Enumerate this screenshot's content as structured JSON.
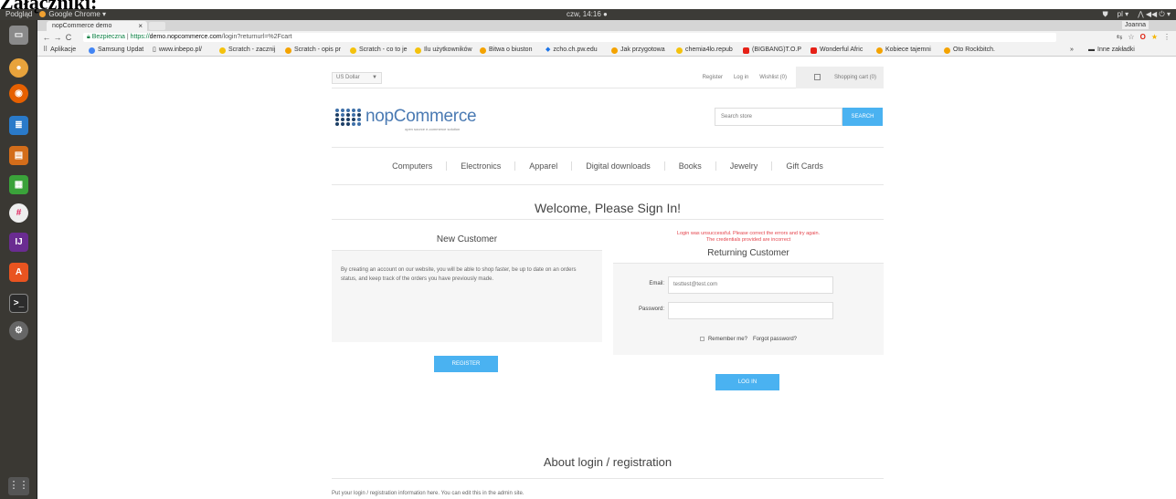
{
  "doc_heading": "Załączniki:",
  "os_panel": {
    "app_label": "Podgląd",
    "chrome_label": "Google Chrome ▾",
    "clock": "czw, 14:16 ●",
    "lang": "pl ▾",
    "sys_icons": "⋀ ◀◀ ⏻ ▾"
  },
  "browser": {
    "tab_title": "nopCommerce demo",
    "tab_close": "×",
    "user_chip": "Joanna",
    "secure_label": "Bezpieczna",
    "url_scheme": "https://",
    "url_host": "demo.nopcommerce.com",
    "url_path": "/login?returnurl=%2Fcart",
    "nav_back": "←",
    "nav_forward": "→",
    "nav_reload": "C",
    "addr_icons": {
      "translate": "⇆",
      "star_plain": "☆",
      "opera": "O",
      "menu": "⋮",
      "bookmark_star": "★"
    }
  },
  "bookmarks": [
    "Aplikacje",
    "Samsung Updat",
    "www.inbepo.pl/",
    "Scratch - zacznij",
    "Scratch - opis pr",
    "Scratch - co to je",
    "Ilu użytkowników",
    "Bitwa o biuston",
    "zcho.ch.pw.edu",
    "Jak przygotowa",
    "chemia4lo.repub",
    "(BIGBANG)T.O.P",
    "Wonderful Afric",
    "Kobiece tajemni",
    "Oto Rockbitch.",
    "»",
    "Inne zakładki"
  ],
  "store": {
    "currency": "US Dollar",
    "header_links": {
      "register": "Register",
      "login": "Log in",
      "wishlist": "Wishlist (0)",
      "cart": "Shopping cart (0)"
    },
    "logo_text": "nopCommerce",
    "logo_sub": "open source e-commerce solution",
    "search_placeholder": "Search store",
    "search_button": "Search",
    "menu": [
      "Computers",
      "Electronics",
      "Apparel",
      "Digital downloads",
      "Books",
      "Jewelry",
      "Gift Cards"
    ],
    "page_title": "Welcome, Please Sign In!",
    "new_customer": {
      "title": "New Customer",
      "text": "By creating an account on our website, you will be able to shop faster, be up to date on an orders status, and keep track of the orders you have previously made.",
      "button": "Register"
    },
    "returning_customer": {
      "error_line1": "Login was unsuccessful. Please correct the errors and try again.",
      "error_line2": "The credentials provided are incorrect",
      "title": "Returning Customer",
      "email_label": "Email:",
      "email_value": "testtest@test.com",
      "password_label": "Password:",
      "password_value": "",
      "remember_label": "Remember me?",
      "forgot_label": "Forgot password?",
      "button": "Log in"
    },
    "about_title": "About login / registration",
    "about_text": "Put your login / registration information here. You can edit this in the admin site."
  },
  "colors": {
    "accent": "#4ab2f1",
    "error": "#e4434b",
    "logo_blue": "#4a7ab3",
    "launcher_bg": "#3a3833"
  }
}
